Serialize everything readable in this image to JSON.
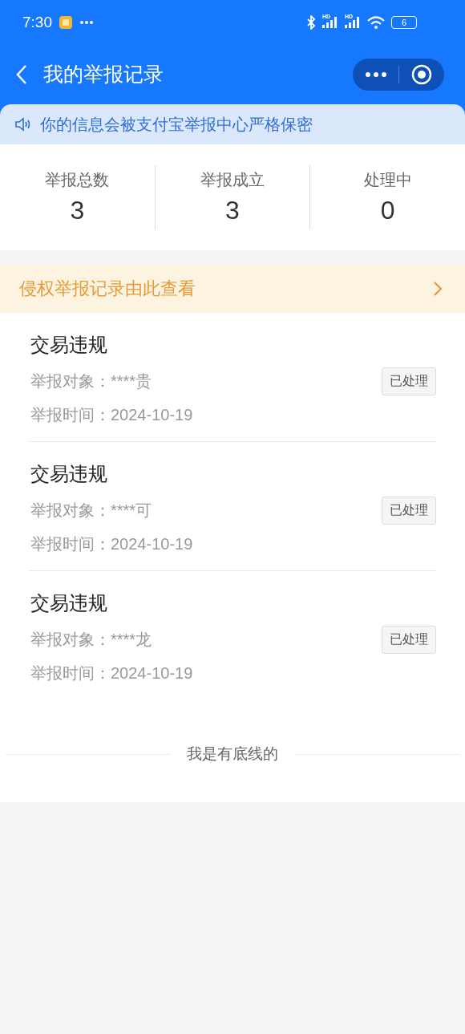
{
  "status_bar": {
    "time": "7:30",
    "network": [
      "HD",
      "HD"
    ],
    "battery": "6"
  },
  "nav": {
    "title": "我的举报记录"
  },
  "notice": {
    "text": "你的信息会被支付宝举报中心严格保密"
  },
  "stats": [
    {
      "label": "举报总数",
      "value": "3"
    },
    {
      "label": "举报成立",
      "value": "3"
    },
    {
      "label": "处理中",
      "value": "0"
    }
  ],
  "banner": {
    "text": "侵权举报记录由此查看"
  },
  "records": [
    {
      "title": "交易违规",
      "target_label": "举报对象：",
      "target": "****贵",
      "time_label": "举报时间：",
      "time": "2024-10-19",
      "status": "已处理"
    },
    {
      "title": "交易违规",
      "target_label": "举报对象：",
      "target": "****可",
      "time_label": "举报时间：",
      "time": "2024-10-19",
      "status": "已处理"
    },
    {
      "title": "交易违规",
      "target_label": "举报对象：",
      "target": "****龙",
      "time_label": "举报时间：",
      "time": "2024-10-19",
      "status": "已处理"
    }
  ],
  "footer": {
    "text": "我是有底线的"
  }
}
